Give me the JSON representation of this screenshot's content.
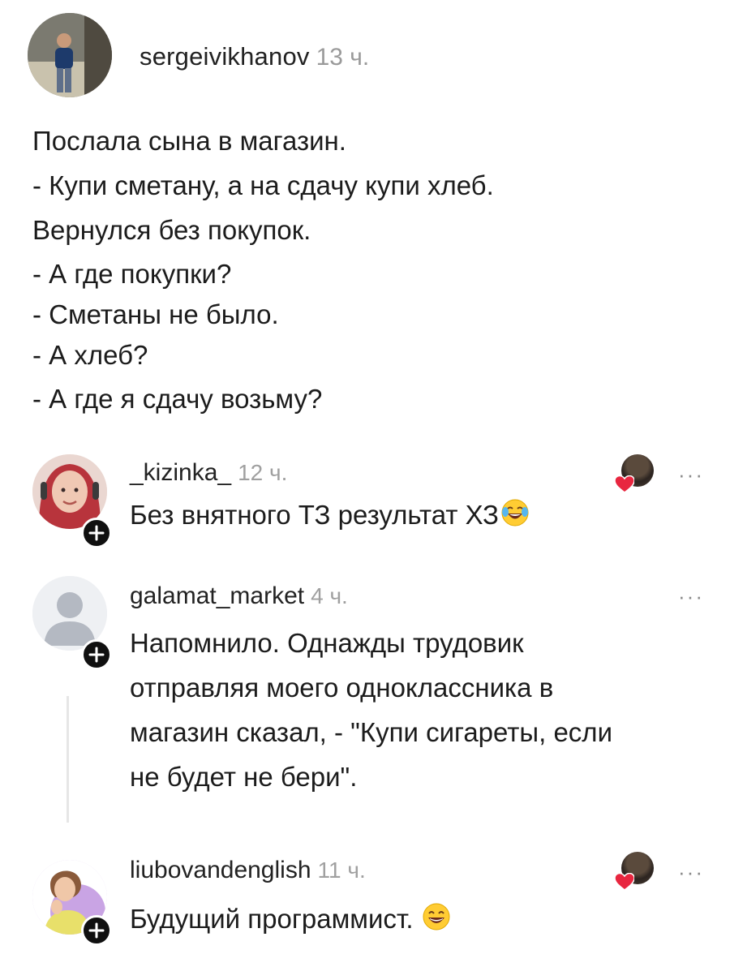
{
  "post": {
    "author": "sergeivikhanov",
    "time": "13 ч.",
    "lines": [
      "Послала сына в магазин.",
      "- Купи сметану, а на сдачу купи хлеб.",
      "Вернулся без покупок.",
      "- А где покупки?",
      "- Сметаны не было.",
      "- А хлеб?",
      "- А где я сдачу возьму?"
    ]
  },
  "comments": [
    {
      "author": "_kizinka_",
      "time": "12 ч.",
      "text": "Без внятного ТЗ результат ХЗ",
      "emoji": "laughing-tears-emoji",
      "liked_by_author": true,
      "more": "···"
    },
    {
      "author": "galamat_market",
      "time": "4 ч.",
      "text_lines": [
        "Напомнило. Однажды трудовик",
        "отправляя моего одноклассника в",
        "магазин сказал, - \"Купи сигареты, если",
        "не будет не бери\"."
      ],
      "liked_by_author": false,
      "more": "···"
    },
    {
      "author": "liubovandenglish",
      "time": "11 ч.",
      "text": "Будущий программист.",
      "emoji": "grinning-emoji",
      "liked_by_author": true,
      "more": "···"
    }
  ],
  "icons": {
    "plus": "plus-icon",
    "heart": "heart-icon",
    "more": "more-icon"
  },
  "colors": {
    "heart": "#e8263f",
    "timestamp": "#9a9a9a",
    "badge": "#101010"
  }
}
